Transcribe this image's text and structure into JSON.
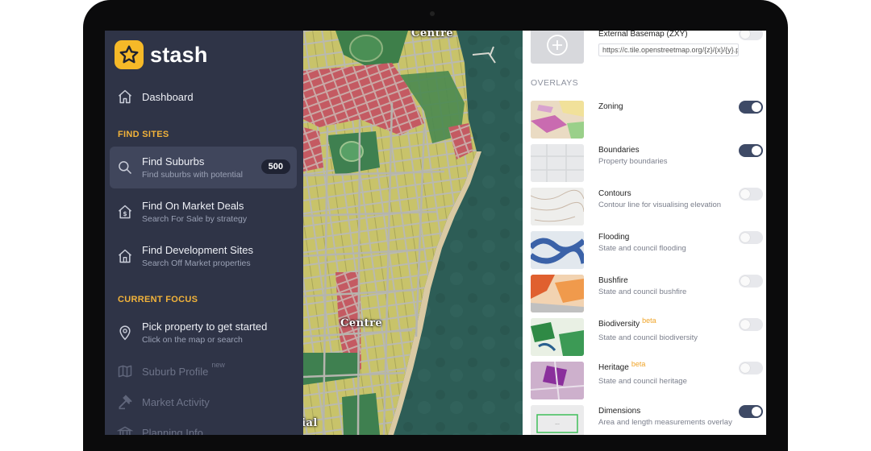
{
  "app": {
    "name": "stash",
    "brand_color": "#f6b928",
    "sidebar_bg": "#2f3447",
    "section_color": "#f2b33a"
  },
  "sidebar": {
    "dashboard": {
      "label": "Dashboard",
      "icon": "home-icon"
    },
    "find_sites_heading": "FIND SITES",
    "find_sites": [
      {
        "title": "Find Suburbs",
        "subtitle": "Find suburbs with potential",
        "badge": "500",
        "icon": "search-icon",
        "active": true
      },
      {
        "title": "Find On Market Deals",
        "subtitle": "Search For Sale by strategy",
        "icon": "house-dollar-icon"
      },
      {
        "title": "Find Development Sites",
        "subtitle": "Search Off Market properties",
        "icon": "house-outline-icon"
      }
    ],
    "current_focus_heading": "CURRENT FOCUS",
    "current_focus": [
      {
        "title": "Pick property to get started",
        "subtitle": "Click on the map or search",
        "icon": "location-pin-icon"
      },
      {
        "title": "Suburb Profile",
        "tag": "new",
        "icon": "map-fold-icon",
        "disabled": true
      },
      {
        "title": "Market Activity",
        "icon": "gavel-icon",
        "disabled": true
      },
      {
        "title": "Planning Info",
        "icon": "building-columns-icon",
        "disabled": true
      }
    ]
  },
  "map": {
    "labels": [
      "Centre",
      "Centre",
      "ial"
    ]
  },
  "panel": {
    "external_basemap": {
      "title": "External Basemap (ZXY)",
      "value": "https://c.tile.openstreetmap.org/{z}/{x}/{y}.png",
      "enabled": false
    },
    "overlays_heading": "OVERLAYS",
    "overlays": [
      {
        "title": "Zoning",
        "subtitle": "",
        "beta": "",
        "enabled": true,
        "thumb": "zoning"
      },
      {
        "title": "Boundaries",
        "subtitle": "Property boundaries",
        "beta": "",
        "enabled": true,
        "thumb": "boundaries"
      },
      {
        "title": "Contours",
        "subtitle": "Contour line for visualising elevation",
        "beta": "",
        "enabled": false,
        "thumb": "contours"
      },
      {
        "title": "Flooding",
        "subtitle": "State and council flooding",
        "beta": "",
        "enabled": false,
        "thumb": "flooding"
      },
      {
        "title": "Bushfire",
        "subtitle": "State and council bushfire",
        "beta": "",
        "enabled": false,
        "thumb": "bushfire"
      },
      {
        "title": "Biodiversity",
        "subtitle": "State and council biodiversity",
        "beta": "beta",
        "enabled": false,
        "thumb": "biodiversity"
      },
      {
        "title": "Heritage",
        "subtitle": "State and council heritage",
        "beta": "beta",
        "enabled": false,
        "thumb": "heritage"
      },
      {
        "title": "Dimensions",
        "subtitle": "Area and length measurements overlay",
        "beta": "",
        "enabled": true,
        "thumb": "dimensions"
      }
    ]
  }
}
